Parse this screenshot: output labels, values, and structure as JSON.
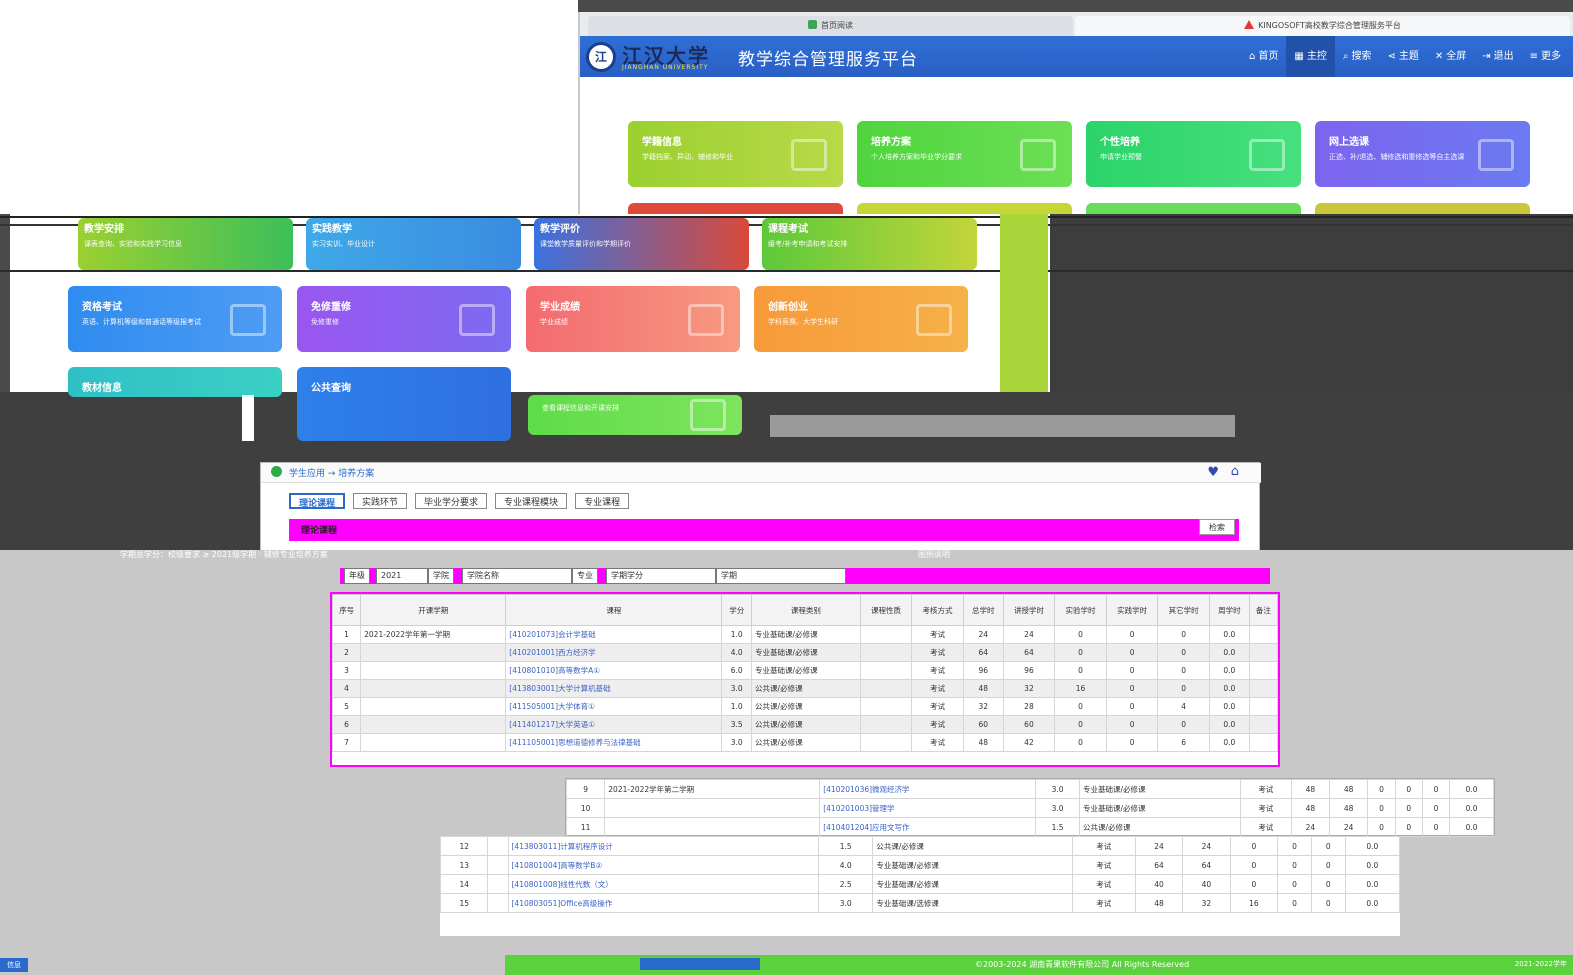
{
  "browser": {
    "tabs": [
      {
        "label": "首页阅读"
      },
      {
        "label": "KINGOSOFT高校教学综合管理服务平台"
      }
    ]
  },
  "header": {
    "school_name": "江汉大学",
    "school_en": "JIANGHAN UNIVERSITY",
    "platform_title": "教学综合管理服务平台",
    "nav": [
      {
        "icon": "home-icon",
        "glyph": "⌂",
        "label": "首页"
      },
      {
        "icon": "grid-icon",
        "glyph": "▦",
        "label": "主控"
      },
      {
        "icon": "search-icon",
        "glyph": "⌕",
        "label": "搜索"
      },
      {
        "icon": "share-icon",
        "glyph": "⋖",
        "label": "主题"
      },
      {
        "icon": "fullscreen-icon",
        "glyph": "✕",
        "label": "全屏"
      },
      {
        "icon": "logout-icon",
        "glyph": "⇥",
        "label": "退出"
      },
      {
        "icon": "menu-icon",
        "glyph": "≡",
        "label": "更多"
      }
    ]
  },
  "tiles_top": [
    {
      "title": "学籍信息",
      "desc": "学籍档案、异动、辅修和毕业",
      "color": "#a5d13a"
    },
    {
      "title": "培养方案",
      "desc": "个人培养方案和毕业学分要求",
      "color": "#5fd84a"
    },
    {
      "title": "个性培养",
      "desc": "申请学业预警",
      "color": "#34d672"
    },
    {
      "title": "网上选课",
      "desc": "正选、补/退选、辅修选和重修选等自主选课",
      "color": "#7a6cf0"
    }
  ],
  "tiles_row2": [
    {
      "title": "教学安排",
      "desc": "课表查询、实验和实践学习信息"
    },
    {
      "title": "实践教学",
      "desc": "实习实训、毕业设计"
    },
    {
      "title": "教学评价",
      "desc": "课堂教学质量评价和学期评价"
    },
    {
      "title": "课程考试",
      "desc": "缓考/补考申请和考试安排"
    }
  ],
  "tiles_row3": [
    {
      "title": "资格考试",
      "desc": "英语、计算机等级和普通话等级报考试",
      "color": "#3b8df0"
    },
    {
      "title": "免修重修",
      "desc": "免修重修",
      "color": "#8f5cf0"
    },
    {
      "title": "学业成绩",
      "desc": "学业成绩",
      "color": "#f4787a"
    },
    {
      "title": "创新创业",
      "desc": "学科竞赛、大学生科研",
      "color": "#f7a63c"
    }
  ],
  "tiles_row4": [
    {
      "title": "教材信息",
      "desc": "",
      "color": "#36c3c9"
    },
    {
      "title": "公共查询",
      "desc": "",
      "color": "#2f7de8"
    },
    {
      "title": "",
      "desc": "查看课程信息和开课安排",
      "color": "#6be04e"
    }
  ],
  "plan": {
    "breadcrumb": "学生应用 → 培养方案",
    "tabs": [
      "理论课程",
      "实践环节",
      "毕业学分要求",
      "专业课程模块",
      "专业课程"
    ],
    "section_label": "理论课程",
    "query_button": "检索",
    "info_line": "学期总学分：校级要求 ≥ 2021级学期  ·  辅修专业培养方案",
    "filters": [
      "年级",
      "2021",
      "学院",
      "学院名称",
      "专业",
      "学期学分",
      "学期"
    ],
    "legend": "图例说明"
  },
  "table": {
    "headers": [
      "序号",
      "开课学期",
      "课程",
      "学分",
      "课程类别",
      "课程性质",
      "考核方式",
      "总学时",
      "讲授学时",
      "实验学时",
      "实践学时",
      "其它学时",
      "周学时",
      "备注"
    ],
    "rows": [
      [
        "1",
        "2021-2022学年第一学期",
        "[410201073]会计学基础",
        "1.0",
        "专业基础课/必修课",
        "",
        "考试",
        "24",
        "24",
        "0",
        "0",
        "0",
        "0.0",
        ""
      ],
      [
        "2",
        "",
        "[410201001]西方经济学",
        "4.0",
        "专业基础课/必修课",
        "",
        "考试",
        "64",
        "64",
        "0",
        "0",
        "0",
        "0.0",
        ""
      ],
      [
        "3",
        "",
        "[410801010]高等数学A①",
        "6.0",
        "专业基础课/必修课",
        "",
        "考试",
        "96",
        "96",
        "0",
        "0",
        "0",
        "0.0",
        ""
      ],
      [
        "4",
        "",
        "[413803001]大学计算机基础",
        "3.0",
        "公共课/必修课",
        "",
        "考试",
        "48",
        "32",
        "16",
        "0",
        "0",
        "0.0",
        ""
      ],
      [
        "5",
        "",
        "[411505001]大学体育①",
        "1.0",
        "公共课/必修课",
        "",
        "考试",
        "32",
        "28",
        "0",
        "0",
        "4",
        "0.0",
        ""
      ],
      [
        "6",
        "",
        "[411401217]大学英语①",
        "3.5",
        "公共课/必修课",
        "",
        "考试",
        "60",
        "60",
        "0",
        "0",
        "0",
        "0.0",
        ""
      ],
      [
        "7",
        "",
        "[411105001]思想道德修养与法律基础",
        "3.0",
        "公共课/必修课",
        "",
        "考试",
        "48",
        "42",
        "0",
        "0",
        "6",
        "0.0",
        ""
      ]
    ]
  },
  "table2": {
    "rows": [
      [
        "9",
        "2021-2022学年第二学期",
        "[410201036]微观经济学",
        "3.0",
        "专业基础课/必修课",
        "考试",
        "48",
        "48",
        "0",
        "0",
        "0",
        "0.0"
      ],
      [
        "10",
        "",
        "[410201003]管理学",
        "3.0",
        "专业基础课/必修课",
        "考试",
        "48",
        "48",
        "0",
        "0",
        "0",
        "0.0"
      ],
      [
        "11",
        "",
        "[410401204]应用文写作",
        "1.5",
        "公共课/必修课",
        "考试",
        "24",
        "24",
        "0",
        "0",
        "0",
        "0.0"
      ]
    ]
  },
  "table3": {
    "rows": [
      [
        "12",
        "",
        "[413803011]计算机程序设计",
        "1.5",
        "公共课/必修课",
        "考试",
        "24",
        "24",
        "0",
        "0",
        "0",
        "0.0"
      ],
      [
        "13",
        "",
        "[410801004]高等数学B②",
        "4.0",
        "专业基础课/必修课",
        "考试",
        "64",
        "64",
        "0",
        "0",
        "0",
        "0.0"
      ],
      [
        "14",
        "",
        "[410801008]线性代数（文）",
        "2.5",
        "专业基础课/必修课",
        "考试",
        "40",
        "40",
        "0",
        "0",
        "0",
        "0.0"
      ],
      [
        "15",
        "",
        "[410803051]Office高级操作",
        "3.0",
        "专业基础课/选修课",
        "考试",
        "48",
        "32",
        "16",
        "0",
        "0",
        "0.0"
      ]
    ]
  },
  "footer": {
    "left": "信息",
    "copyright": "©2003-2024 湖南青果软件有限公司 All Rights Reserved",
    "right": "2021-2022学年"
  },
  "colors": {
    "accent": "#2f6fd6",
    "magenta": "#ff00ff",
    "green": "#5bd13d"
  }
}
